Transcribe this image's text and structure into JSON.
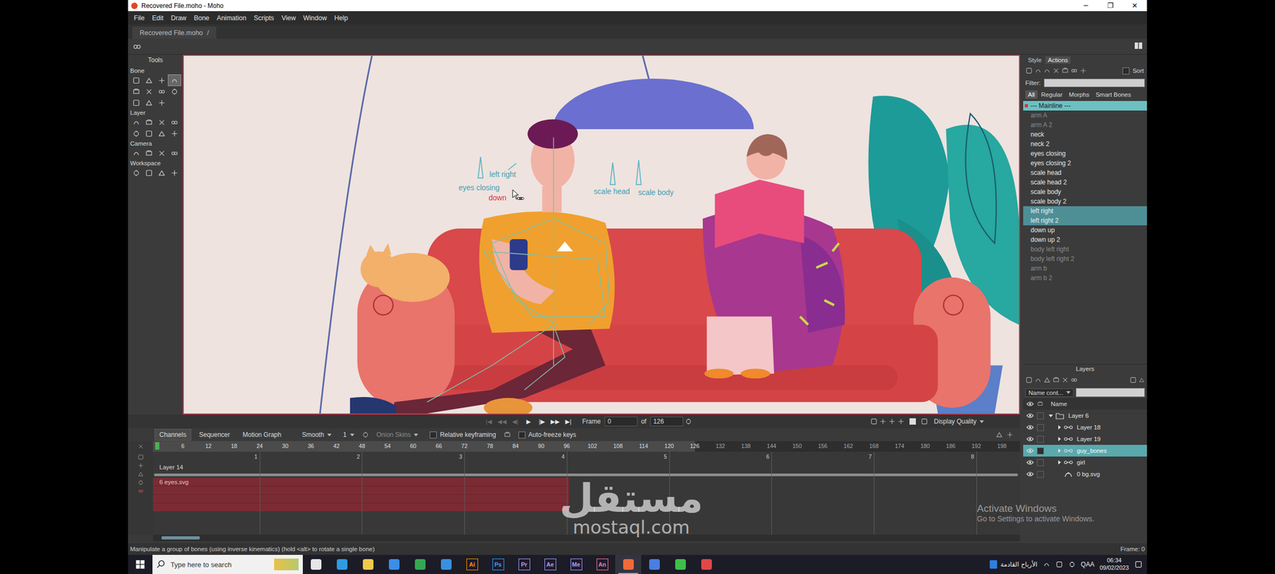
{
  "window": {
    "title": "Recovered File.moho - Moho",
    "controls": [
      "─",
      "❐",
      "✕"
    ]
  },
  "menu": [
    "File",
    "Edit",
    "Draw",
    "Bone",
    "Animation",
    "Scripts",
    "View",
    "Window",
    "Help"
  ],
  "document_tab": {
    "label": "Recovered File.moho",
    "mark": "/"
  },
  "tools": {
    "title": "Tools",
    "sections": [
      {
        "label": "Bone",
        "tools": [
          {
            "selected": false
          },
          {
            "selected": false
          },
          {
            "selected": false
          },
          {
            "selected": true
          },
          {
            "selected": false
          },
          {
            "selected": false
          },
          {
            "selected": false
          },
          {
            "selected": false
          },
          {
            "selected": false
          },
          {
            "selected": false
          },
          {
            "selected": false
          }
        ]
      },
      {
        "label": "Layer",
        "tools": [
          {
            "selected": false
          },
          {
            "selected": false
          },
          {
            "selected": false
          },
          {
            "selected": false
          },
          {
            "selected": false
          },
          {
            "selected": false
          },
          {
            "selected": false
          },
          {
            "selected": false
          }
        ]
      },
      {
        "label": "Camera",
        "tools": [
          {
            "selected": false
          },
          {
            "selected": false
          },
          {
            "selected": false
          },
          {
            "selected": false
          }
        ]
      },
      {
        "label": "Workspace",
        "tools": [
          {
            "selected": false
          },
          {
            "selected": false
          },
          {
            "selected": false
          },
          {
            "selected": false
          }
        ]
      }
    ]
  },
  "canvas": {
    "bones": [
      {
        "label": "left right",
        "selected": false
      },
      {
        "label": "eyes closing",
        "selected": false
      },
      {
        "label": "down",
        "selected": true
      },
      {
        "label": "scale head",
        "selected": false
      },
      {
        "label": "scale body",
        "selected": false
      }
    ]
  },
  "playback": {
    "buttons": [
      {
        "glyph": "|◀",
        "disabled": true
      },
      {
        "glyph": "◀◀",
        "disabled": true
      },
      {
        "glyph": "◀|",
        "disabled": true
      },
      {
        "glyph": "▶",
        "disabled": false
      },
      {
        "glyph": "|▶",
        "disabled": false
      },
      {
        "glyph": "▶▶",
        "disabled": false
      },
      {
        "glyph": "▶|",
        "disabled": false
      }
    ],
    "frame_label": "Frame",
    "frame": "0",
    "of": "of",
    "total": "126",
    "quality": "Display Quality"
  },
  "timeline": {
    "tabs": [
      {
        "label": "Channels",
        "selected": true
      },
      {
        "label": "Sequencer",
        "selected": false
      },
      {
        "label": "Motion Graph",
        "selected": false
      }
    ],
    "interpolation": "Smooth",
    "step": "1",
    "onion": "Onion Skins",
    "relative": {
      "label": "Relative keyframing",
      "checked": false
    },
    "autofreeze": {
      "label": "Auto-freeze keys",
      "checked": false
    },
    "ruler": [
      "6",
      "12",
      "18",
      "24",
      "30",
      "36",
      "42",
      "48",
      "54",
      "60",
      "66",
      "72",
      "78",
      "84",
      "90",
      "96",
      "102",
      "108",
      "114",
      "120",
      "126",
      "132",
      "138",
      "144",
      "150",
      "156",
      "162",
      "168",
      "174",
      "180",
      "186",
      "192",
      "198"
    ],
    "range": {
      "level": 0.625
    },
    "seconds": [
      "1",
      "2",
      "3",
      "4",
      "5",
      "6",
      "7",
      "8"
    ],
    "tracks": [
      {
        "label": "Layer 14",
        "kind": "group"
      },
      {
        "label": "6 eyes.svg",
        "kind": "layer",
        "level": 0.48
      }
    ]
  },
  "actions_panel": {
    "tabs": [
      {
        "label": "Style",
        "selected": false
      },
      {
        "label": "Actions",
        "selected": true
      }
    ],
    "sort": {
      "label": "Sort",
      "checked": false
    },
    "filter": {
      "label": "Filter:",
      "value": ""
    },
    "categories": [
      {
        "label": "All",
        "selected": true
      },
      {
        "label": "Regular",
        "selected": false
      },
      {
        "label": "Morphs",
        "selected": false
      },
      {
        "label": "Smart Bones",
        "selected": false
      }
    ],
    "items": [
      {
        "label": "--- Mainline ---",
        "active": true,
        "selected": false,
        "disabled": false
      },
      {
        "label": "arm A",
        "active": false,
        "selected": false,
        "disabled": true
      },
      {
        "label": "arm A 2",
        "active": false,
        "selected": false,
        "disabled": true
      },
      {
        "label": "neck",
        "active": false,
        "selected": false,
        "disabled": false
      },
      {
        "label": "neck 2",
        "active": false,
        "selected": false,
        "disabled": false
      },
      {
        "label": "eyes closing",
        "active": false,
        "selected": false,
        "disabled": false
      },
      {
        "label": "eyes closing 2",
        "active": false,
        "selected": false,
        "disabled": false
      },
      {
        "label": "scale head",
        "active": false,
        "selected": false,
        "disabled": false
      },
      {
        "label": "scale head 2",
        "active": false,
        "selected": false,
        "disabled": false
      },
      {
        "label": "scale body",
        "active": false,
        "selected": false,
        "disabled": false
      },
      {
        "label": "scale body 2",
        "active": false,
        "selected": false,
        "disabled": false
      },
      {
        "label": "left right",
        "active": false,
        "selected": true,
        "disabled": false
      },
      {
        "label": "left right 2",
        "active": false,
        "selected": true,
        "disabled": false
      },
      {
        "label": "down up",
        "active": false,
        "selected": false,
        "disabled": false
      },
      {
        "label": "down up 2",
        "active": false,
        "selected": false,
        "disabled": false
      },
      {
        "label": "body left right",
        "active": false,
        "selected": false,
        "disabled": true
      },
      {
        "label": "body left right 2",
        "active": false,
        "selected": false,
        "disabled": true
      },
      {
        "label": "arm b",
        "active": false,
        "selected": false,
        "disabled": true
      },
      {
        "label": "arm b 2",
        "active": false,
        "selected": false,
        "disabled": true
      }
    ]
  },
  "layers_panel": {
    "title": "Layers",
    "sort": "Name cont...",
    "column": "Name",
    "rows": [
      {
        "name": "Layer 6",
        "kind": "folder",
        "depth": 0,
        "expandable": true,
        "expanded": true,
        "selected": false,
        "visible": true
      },
      {
        "name": "Layer 18",
        "kind": "bone",
        "depth": 1,
        "expandable": true,
        "expanded": false,
        "selected": false,
        "visible": true
      },
      {
        "name": "Layer 19",
        "kind": "bone",
        "depth": 1,
        "expandable": true,
        "expanded": false,
        "selected": false,
        "visible": true
      },
      {
        "name": "guy_bones",
        "kind": "bone",
        "depth": 1,
        "expandable": true,
        "expanded": false,
        "selected": true,
        "visible": true
      },
      {
        "name": "girl",
        "kind": "bone",
        "depth": 1,
        "expandable": true,
        "expanded": false,
        "selected": false,
        "visible": true
      },
      {
        "name": "0 bg.svg",
        "kind": "vector",
        "depth": 1,
        "expandable": false,
        "expanded": false,
        "selected": false,
        "visible": true
      }
    ]
  },
  "status_bar": {
    "hint": "Manipulate a group of bones (using inverse kinematics) (hold <alt> to rotate a single bone)",
    "frame": "Frame: 0"
  },
  "watermark": {
    "arabic": "مستقل",
    "latin": "mostaql.com"
  },
  "activation": {
    "title": "Activate Windows",
    "subtitle": "Go to Settings to activate Windows."
  },
  "taskbar": {
    "search": {
      "placeholder": "Type here to search"
    },
    "apps": [
      {
        "kind": "icon",
        "color": "#e6e6e6",
        "active": false
      },
      {
        "kind": "icon",
        "color": "#2f9be0",
        "active": false
      },
      {
        "kind": "icon",
        "color": "#f2c94c",
        "active": false
      },
      {
        "kind": "icon",
        "color": "#3a8ee6",
        "active": false
      },
      {
        "kind": "icon",
        "color": "#34a853",
        "active": false
      },
      {
        "kind": "icon",
        "color": "#3b8fe0",
        "active": false
      },
      {
        "kind": "glyph",
        "label": "Ai",
        "color": "#ff9a00",
        "active": false
      },
      {
        "kind": "glyph",
        "label": "Ps",
        "color": "#31a8ff",
        "active": false
      },
      {
        "kind": "glyph",
        "label": "Pr",
        "color": "#a3a3ff",
        "active": false
      },
      {
        "kind": "glyph",
        "label": "Ae",
        "color": "#a3a3ff",
        "active": false
      },
      {
        "kind": "glyph",
        "label": "Me",
        "color": "#a3a3ff",
        "active": false
      },
      {
        "kind": "glyph",
        "label": "An",
        "color": "#ff7a9a",
        "active": false
      },
      {
        "kind": "icon",
        "color": "#f06a3a",
        "active": true
      },
      {
        "kind": "icon",
        "color": "#4a7ee0",
        "active": false
      },
      {
        "kind": "icon",
        "color": "#3fbf4a",
        "active": false
      },
      {
        "kind": "icon",
        "color": "#e04848",
        "active": false
      }
    ],
    "news": "الأرباح القادمة",
    "language": "QAA",
    "time": "06:34",
    "date": "09/02/2023"
  }
}
